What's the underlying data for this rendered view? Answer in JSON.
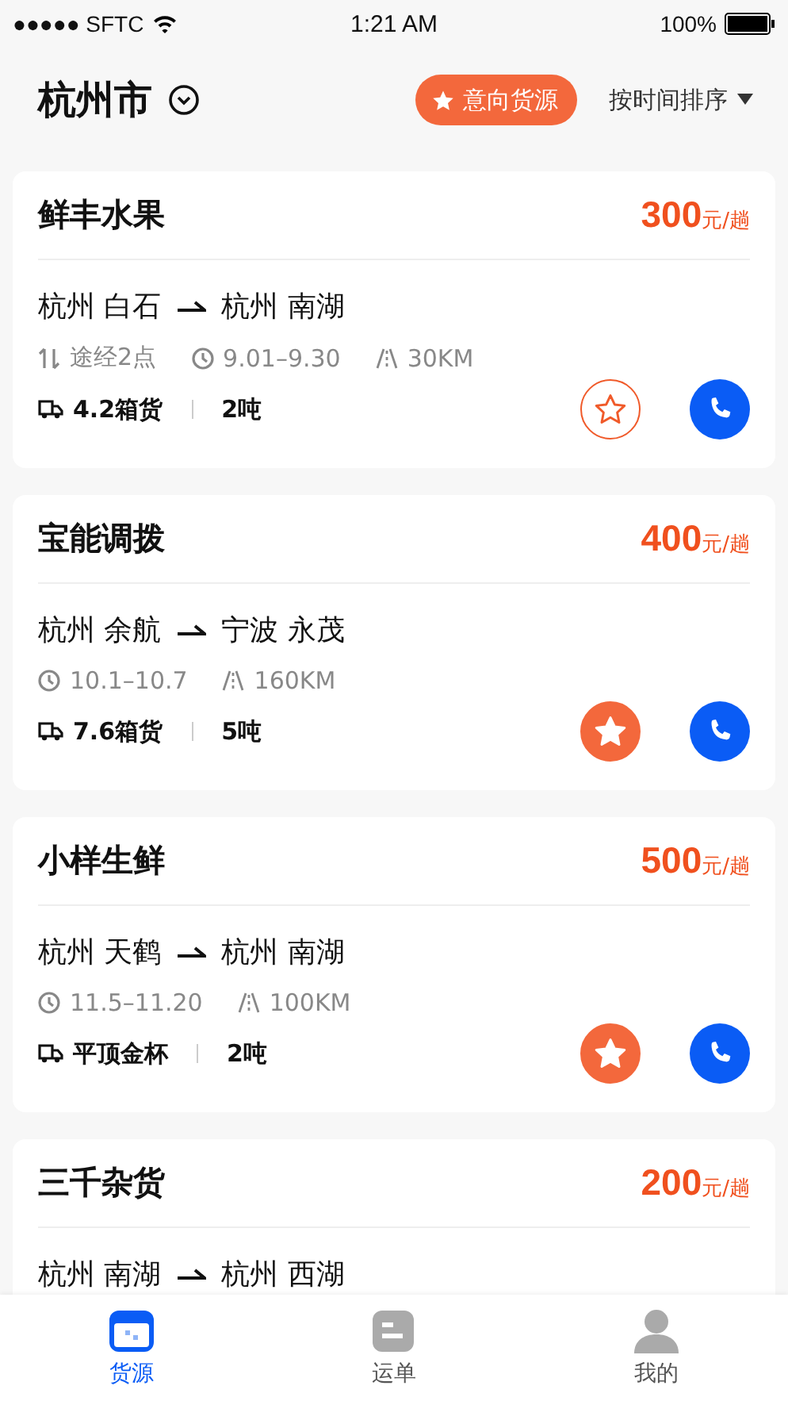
{
  "status_bar": {
    "carrier": "●●●●● SFTC",
    "time": "1:21 AM",
    "battery": "100%"
  },
  "header": {
    "city": "杭州市",
    "intent_button": "意向货源",
    "sort": "按时间排序"
  },
  "cards": [
    {
      "title": "鲜丰水果",
      "price": "300",
      "unit": "元/趟",
      "from": "杭州 白石",
      "to": "杭州 南湖",
      "meta": [
        {
          "kind": "via",
          "text": "途经2点"
        },
        {
          "kind": "time",
          "text": "9.01–9.30"
        },
        {
          "kind": "distance",
          "text": "30KM"
        }
      ],
      "cargo": "4.2箱货",
      "weight": "2吨",
      "favorited": false
    },
    {
      "title": "宝能调拨",
      "price": "400",
      "unit": "元/趟",
      "from": "杭州 余航",
      "to": "宁波 永茂",
      "meta": [
        {
          "kind": "time",
          "text": "10.1–10.7"
        },
        {
          "kind": "distance",
          "text": "160KM"
        }
      ],
      "cargo": "7.6箱货",
      "weight": "5吨",
      "favorited": true
    },
    {
      "title": "小样生鲜",
      "price": "500",
      "unit": "元/趟",
      "from": "杭州 天鹤",
      "to": "杭州 南湖",
      "meta": [
        {
          "kind": "time",
          "text": "11.5–11.20"
        },
        {
          "kind": "distance",
          "text": "100KM"
        }
      ],
      "cargo": "平顶金杯",
      "weight": "2吨",
      "favorited": true
    },
    {
      "title": "三千杂货",
      "price": "200",
      "unit": "元/趟",
      "from": "杭州 南湖",
      "to": "杭州 西湖"
    }
  ],
  "tabs": [
    {
      "label": "货源",
      "kind": "cargo",
      "selected": true
    },
    {
      "label": "运单",
      "kind": "orders",
      "selected": false
    },
    {
      "label": "我的",
      "kind": "me",
      "selected": false
    }
  ]
}
